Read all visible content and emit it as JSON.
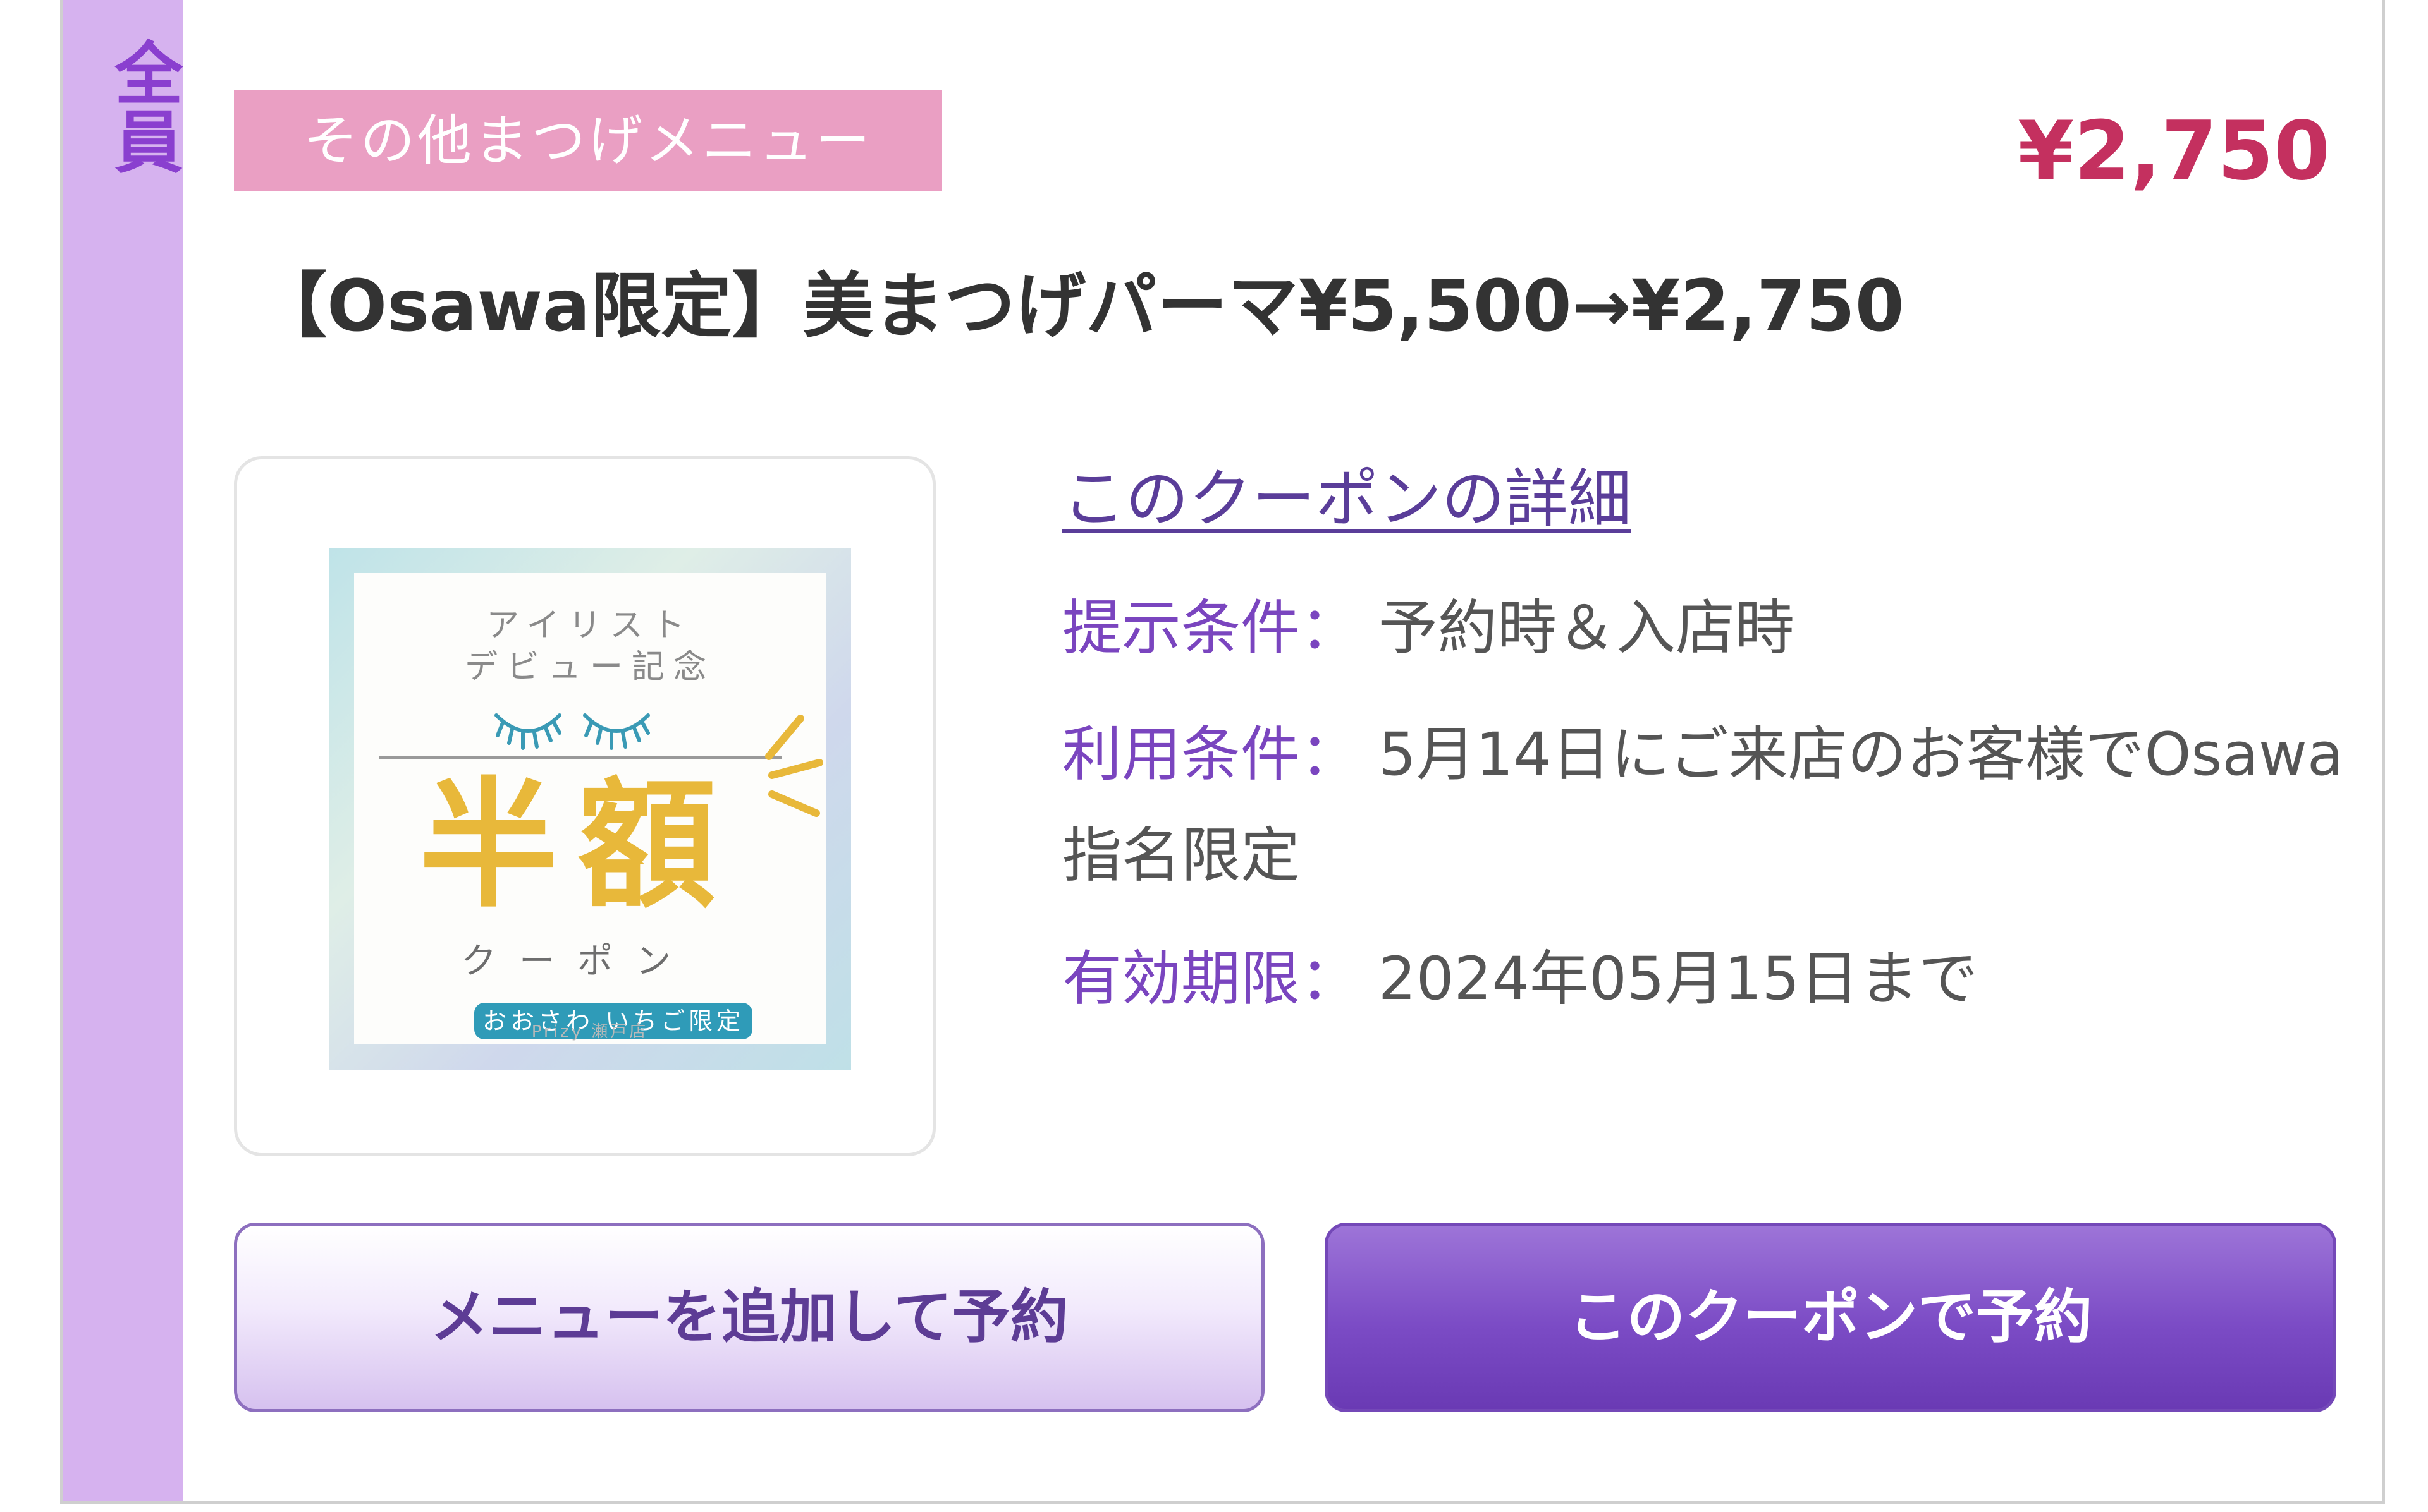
{
  "badge": {
    "label": "全員"
  },
  "category_tag": "その他まつげメニュー",
  "price": "¥2,750",
  "title": "【Osawa限定】美まつげパーマ¥5,500→¥2,750",
  "coupon_image": {
    "top_line1": "アイリスト",
    "top_line2": "デビュー記念",
    "main": "半額",
    "sub": "クーポン",
    "pill": "おおさわ いちご限定",
    "brand": "Prizy 瀬戸店"
  },
  "detail_link": "このクーポンの詳細",
  "conditions": [
    {
      "label": "提示条件：",
      "value": "予約時＆入店時"
    },
    {
      "label": "利用条件：",
      "value": "5月14日にご来店のお客様でOsawa指名限定"
    },
    {
      "label": "有効期限：",
      "value": "2024年05月15日まで"
    }
  ],
  "buttons": {
    "add_menu": "メニューを追加して予約",
    "reserve": "このクーポンで予約"
  },
  "colors": {
    "side_bar": "#d6b2ef",
    "tag_bg": "#ea9fc3",
    "price": "#c4305f",
    "accent_purple": "#7a45bf"
  }
}
